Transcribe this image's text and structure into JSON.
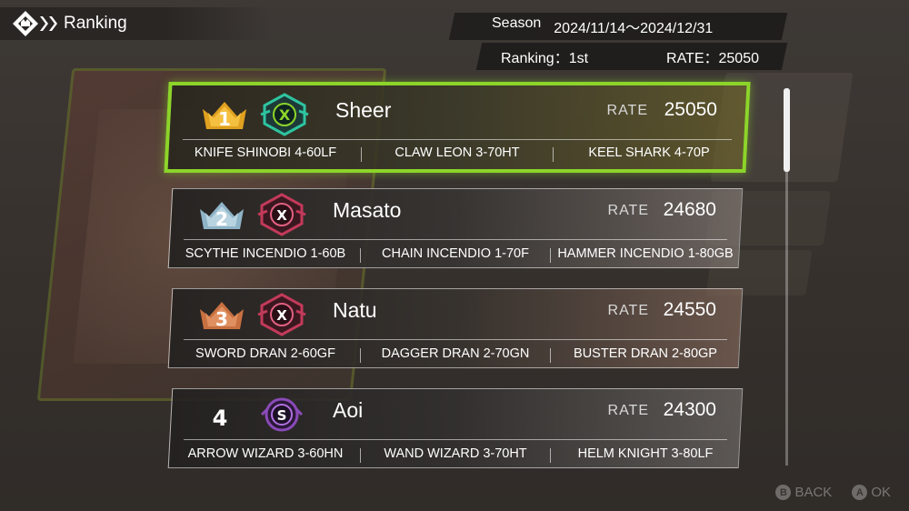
{
  "header": {
    "title": "Ranking"
  },
  "season": {
    "label": "Season",
    "range": "2024/11/14～2024/12/31"
  },
  "summary": {
    "ranking": "Ranking：1st",
    "rate": "RATE：25050"
  },
  "rate_label": "RATE",
  "players": [
    {
      "rank": "1",
      "name": "Sheer",
      "rate": "25050",
      "emblem_color": "#2ec4a0",
      "parts": [
        "KNIFE SHINOBI 4-60LF",
        "CLAW LEON 3-70HT",
        "KEEL SHARK 4-70P"
      ]
    },
    {
      "rank": "2",
      "name": "Masato",
      "rate": "24680",
      "emblem_color": "#c23a5a",
      "parts": [
        "SCYTHE INCENDIO 1-60B",
        "CHAIN INCENDIO 1-70F",
        "HAMMER INCENDIO 1-80GB"
      ]
    },
    {
      "rank": "3",
      "name": "Natu",
      "rate": "24550",
      "emblem_color": "#c23a5a",
      "parts": [
        "SWORD DRAN 2-60GF",
        "DAGGER DRAN 2-70GN",
        "BUSTER DRAN 2-80GP"
      ]
    },
    {
      "rank": "4",
      "name": "Aoi",
      "rate": "24300",
      "emblem_color": "#8a4ab8",
      "parts": [
        "ARROW WIZARD 3-60HN",
        "WAND WIZARD 3-70HT",
        "HELM KNIGHT 3-80LF"
      ]
    }
  ],
  "footer": {
    "back_key": "B",
    "back": "BACK",
    "ok_key": "A",
    "ok": "OK"
  },
  "colors": {
    "highlight": "#8cd42a",
    "gold": "#e0a020",
    "silver": "#8fb4c8",
    "bronze": "#c87040"
  }
}
